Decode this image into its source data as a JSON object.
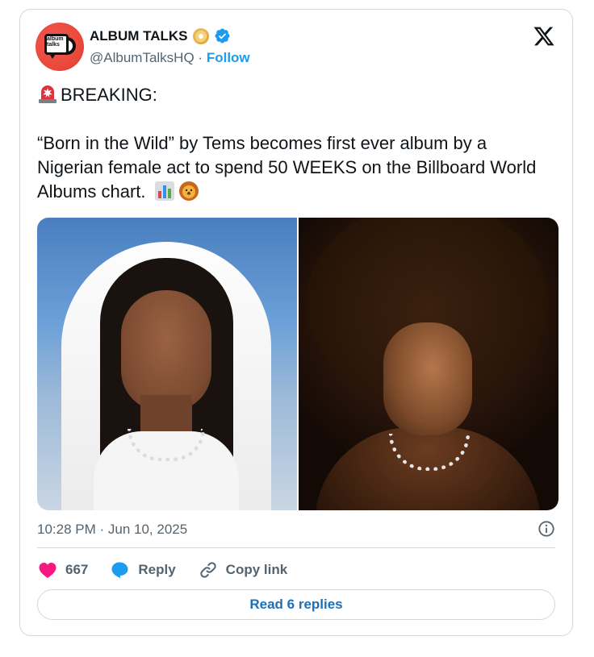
{
  "author": {
    "display_name": "ALBUM TALKS",
    "handle": "@AlbumTalksHQ",
    "separator": "·",
    "follow_label": "Follow",
    "avatar_text": "album talks",
    "verified_color": "#1d9bf0"
  },
  "tweet": {
    "line1": "BREAKING:",
    "line2": "“Born in the Wild” by Tems becomes first ever album by a Nigerian female act to spend 50 WEEKS on the Billboard World Albums chart.",
    "emojis": [
      "siren-emoji",
      "bar-chart-emoji",
      "lion-emoji"
    ]
  },
  "media": {
    "count": 2
  },
  "meta": {
    "timestamp": "10:28 PM · Jun 10, 2025"
  },
  "actions": {
    "likes_count": "667",
    "reply_label": "Reply",
    "copy_link_label": "Copy link",
    "like_color": "#f91880",
    "reply_color": "#1d9bf0"
  },
  "footer": {
    "read_replies_label": "Read 6 replies"
  }
}
